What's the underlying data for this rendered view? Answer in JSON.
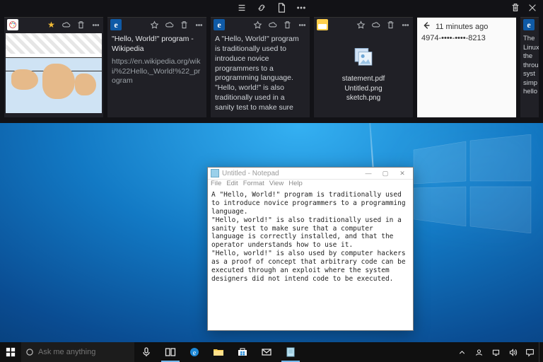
{
  "timeline": {
    "cards": [
      {
        "app": "paint",
        "starred": true,
        "type": "image"
      },
      {
        "app": "edge",
        "title": "\"Hello, World!\" program - Wikipedia",
        "url": "https://en.wikipedia.org/wiki/%22Hello,_World!%22_program"
      },
      {
        "app": "edge",
        "snippet": "A \"Hello, World!\" program is traditionally used to introduce novice programmers to a programming language. \"Hello, world!\" is also traditionally used in a sanity test to make sure"
      },
      {
        "app": "explorer",
        "files": [
          "statement.pdf",
          "Untitled.png",
          "sketch.png"
        ]
      },
      {
        "app": "white",
        "time_ago": "11 minutes ago",
        "masked": "4974-••••-••••-8213"
      },
      {
        "app": "edge",
        "snippet": "The Linux the throu syst simp hello"
      }
    ]
  },
  "notepad": {
    "title": "Untitled - Notepad",
    "menu": [
      "File",
      "Edit",
      "Format",
      "View",
      "Help"
    ],
    "body": "A \"Hello, World!\" program is traditionally used to introduce novice programmers to a programming language.\n\"Hello, world!\" is also traditionally used in a sanity test to make sure that a computer language is correctly installed, and that the operator understands how to use it.\n\"Hello, world!\" is also used by computer hackers as a proof of concept that arbitrary code can be executed through an exploit where the system designers did not intend code to be executed."
  },
  "taskbar": {
    "search_placeholder": "Ask me anything"
  }
}
